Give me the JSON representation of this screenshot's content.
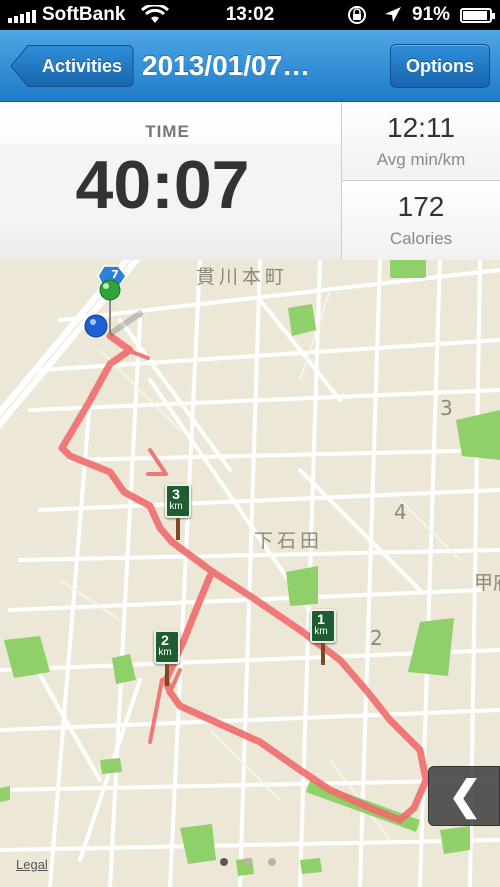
{
  "status_bar": {
    "carrier": "SoftBank",
    "time": "13:02",
    "battery_percent": "91%",
    "battery_level": 0.91
  },
  "nav": {
    "back_label": "Activities",
    "title": "2013/01/07…",
    "options_label": "Options"
  },
  "stats": {
    "main": {
      "label": "TIME",
      "value": "40:07"
    },
    "pace": {
      "value": "12:11",
      "label": "Avg min/km"
    },
    "calories": {
      "value": "172",
      "label": "Calories"
    }
  },
  "map": {
    "labels": {
      "area_top": "貫川本町",
      "area_center": "下石田",
      "area_right": "甲府",
      "block_3": "3",
      "block_4": "4",
      "block_2": "2",
      "route_shield": "7"
    },
    "km_markers": [
      {
        "num": "1",
        "unit": "km"
      },
      {
        "num": "2",
        "unit": "km"
      },
      {
        "num": "3",
        "unit": "km"
      }
    ],
    "legal_label": "Legal",
    "page_dots": {
      "count": 3,
      "active_index": 0
    },
    "route_color": "#ef6c6c",
    "park_color": "#8fd06a"
  },
  "colors": {
    "nav_blue": "#2b86d3",
    "map_background": "#ede7d8"
  }
}
